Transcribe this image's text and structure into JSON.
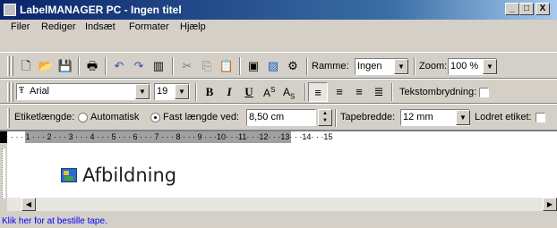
{
  "window": {
    "title": "LabelMANAGER PC - Ingen titel",
    "controls": {
      "minimize": "_",
      "maximize": "□",
      "close": "X"
    }
  },
  "menu": [
    "Filer",
    "Rediger",
    "Indsæt",
    "Formater",
    "Hjælp"
  ],
  "toolbar1": {
    "icons": [
      "new-icon",
      "open-icon",
      "save-icon",
      "print-icon",
      "undo-icon",
      "redo-icon",
      "barcode-icon",
      "cut-icon",
      "copy-icon",
      "paste-icon",
      "preview-icon",
      "image-icon",
      "symbols-icon"
    ],
    "ramme_label": "Ramme:",
    "ramme_value": "Ingen",
    "zoom_label": "Zoom:",
    "zoom_value": "100 %"
  },
  "toolbar2": {
    "font_value": "Arial",
    "size_value": "19",
    "bold": "B",
    "italic": "I",
    "underline": "U",
    "superscript_base": "A",
    "superscript_mark": "S",
    "subscript_base": "A",
    "subscript_mark": "S",
    "wrap_label": "Tekstombrydning:"
  },
  "toolbar3": {
    "length_label": "Etiketlængde:",
    "auto_label": "Automatisk",
    "fixed_label": "Fast længde ved:",
    "fixed_value": "8,50 cm",
    "tape_label": "Tapebredde:",
    "tape_value": "12 mm",
    "vertical_label": "Lodret etiket:"
  },
  "ruler": {
    "ticks": "· · · 1 · · · 2 · · · 3 · · · 4 · · · 5 · · · 6 · · · 7 · · · 8 · · · 9 · · ·10· · ·11· · ·12· · ·13· · ·14· · ·15"
  },
  "canvas": {
    "image_caption": "Afbildning"
  },
  "status": "Klik her for at bestille tape."
}
